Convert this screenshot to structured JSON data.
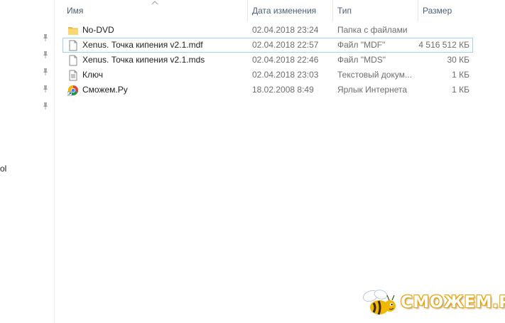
{
  "sidebar": {
    "partial_label": "ol",
    "pins": [
      "pin-icon",
      "pin-icon",
      "pin-icon",
      "pin-icon",
      "pin-icon"
    ]
  },
  "columns": {
    "name": "Имя",
    "date": "Дата изменения",
    "type": "Тип",
    "size": "Размер"
  },
  "files": [
    {
      "name": "No-DVD",
      "date": "02.04.2018 23:24",
      "type": "Папка с файлами",
      "size": "",
      "icon": "folder-icon"
    },
    {
      "name": "Xenus. Точка кипения v2.1.mdf",
      "date": "02.04.2018 22:57",
      "type": "Файл \"MDF\"",
      "size": "4 516 512 КБ",
      "icon": "file-icon",
      "selected": true
    },
    {
      "name": "Xenus. Точка кипения v2.1.mds",
      "date": "02.04.2018 22:46",
      "type": "Файл \"MDS\"",
      "size": "30 КБ",
      "icon": "file-icon"
    },
    {
      "name": "Ключ",
      "date": "02.04.2018 23:03",
      "type": "Текстовый докум...",
      "size": "1 КБ",
      "icon": "text-file-icon"
    },
    {
      "name": "Сможем.Ру",
      "date": "18.02.2008 8:49",
      "type": "Ярлык Интернета",
      "size": "1 КБ",
      "icon": "chrome-shortcut-icon"
    }
  ],
  "watermark": {
    "text": "СМОЖЕМ.РУ"
  },
  "colors": {
    "selection_border": "#99d1ff",
    "header_text": "#4c607a",
    "folder": "#f8d775"
  }
}
